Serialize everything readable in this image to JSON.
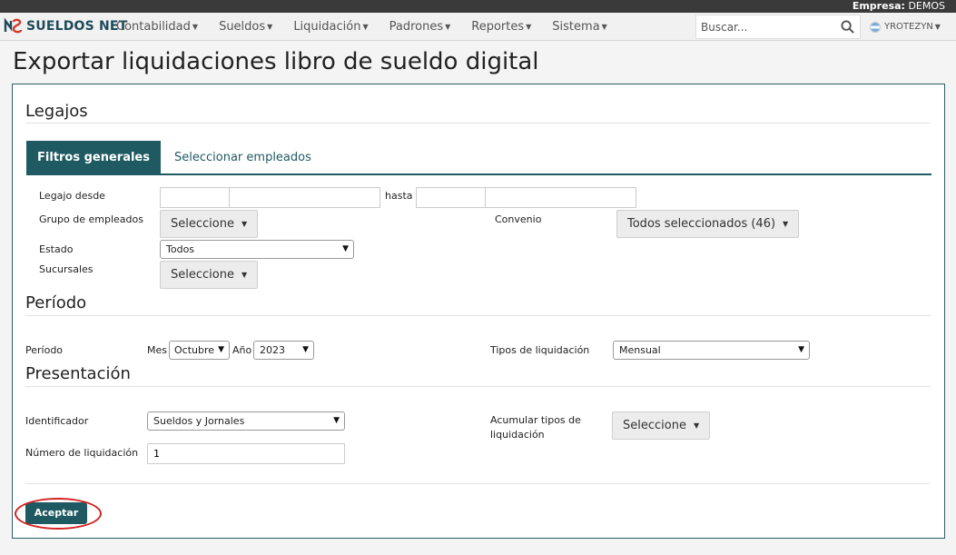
{
  "topbar": {
    "company_label": "Empresa:",
    "company_value": "DEMOS"
  },
  "nav": {
    "brand": "SUELDOS NET",
    "menu": [
      "Contabilidad",
      "Sueldos",
      "Liquidación",
      "Padrones",
      "Reportes",
      "Sistema"
    ],
    "search_placeholder": "Buscar...",
    "user": "YROTEZYN"
  },
  "page": {
    "title": "Exportar liquidaciones libro de sueldo digital"
  },
  "legajos": {
    "title": "Legajos",
    "tabs": [
      "Filtros generales",
      "Seleccionar empleados"
    ],
    "legajo_desde_label": "Legajo desde",
    "hasta_label": "hasta",
    "grupo_label": "Grupo de empleados",
    "grupo_value": "Seleccione",
    "convenio_label": "Convenio",
    "convenio_value": "Todos seleccionados (46)",
    "estado_label": "Estado",
    "estado_value": "Todos",
    "sucursales_label": "Sucursales",
    "sucursales_value": "Seleccione"
  },
  "periodo": {
    "title": "Período",
    "label": "Período",
    "mes_label": "Mes",
    "mes_value": "Octubre",
    "anio_label": "Año",
    "anio_value": "2023",
    "tipos_label": "Tipos de liquidación",
    "tipos_value": "Mensual"
  },
  "presentacion": {
    "title": "Presentación",
    "identificador_label": "Identificador",
    "identificador_value": "Sueldos y Jornales",
    "acumular_label_1": "Acumular tipos de",
    "acumular_label_2": "liquidación",
    "acumular_value": "Seleccione",
    "numero_label": "Número de liquidación",
    "numero_value": "1"
  },
  "actions": {
    "accept": "Aceptar"
  },
  "colors": {
    "primary": "#1f5a62",
    "highlight_ring": "#d42222"
  }
}
